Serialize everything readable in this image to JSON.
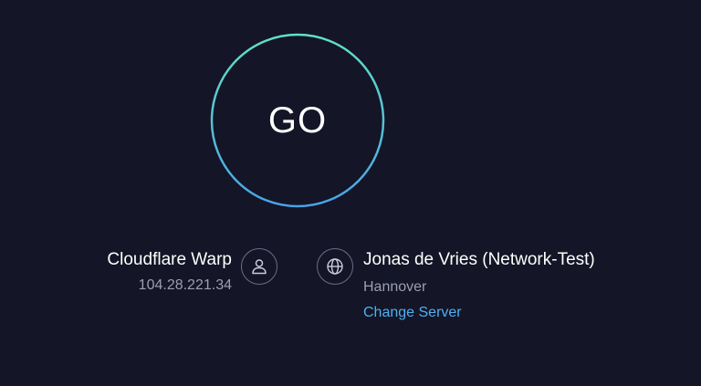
{
  "go_button": {
    "label": "GO",
    "ring_gradient": [
      "#63e0c4",
      "#4aa3e8"
    ]
  },
  "isp": {
    "name": "Cloudflare Warp",
    "ip": "104.28.221.34",
    "icon": "user-icon"
  },
  "server": {
    "name": "Jonas de Vries (Network-Test)",
    "city": "Hannover",
    "change_label": "Change Server",
    "icon": "globe-icon"
  },
  "colors": {
    "background": "#141526",
    "link": "#4fb0f0",
    "muted_text": "#9b9fb3"
  }
}
